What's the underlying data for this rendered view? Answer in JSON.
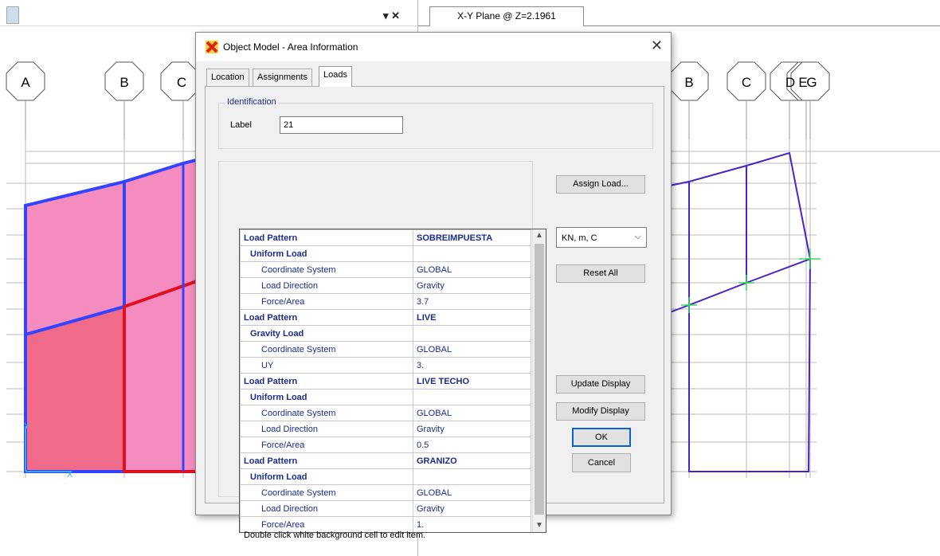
{
  "left_view": {
    "pane_controls": "▾ ✕",
    "grid_labels": [
      "A",
      "B",
      "C"
    ]
  },
  "right_view": {
    "tab_label": "X-Y Plane @ Z=2.1961",
    "grid_labels": [
      "B",
      "C",
      "D",
      "E",
      "G"
    ]
  },
  "dialog": {
    "title": "Object Model - Area Information",
    "close_glyph": "✕",
    "tabs": [
      "Location",
      "Assignments",
      "Loads"
    ],
    "identification": {
      "legend": "Identification",
      "label_caption": "Label",
      "label_value": "21"
    },
    "grid_rows": [
      {
        "kind": "pattern",
        "name": "Load Pattern",
        "value": "SOBREIMPUESTA"
      },
      {
        "kind": "sub",
        "name": "Uniform Load",
        "value": ""
      },
      {
        "kind": "prop",
        "name": "Coordinate System",
        "value": "GLOBAL"
      },
      {
        "kind": "prop",
        "name": "Load Direction",
        "value": "Gravity"
      },
      {
        "kind": "prop",
        "name": "Force/Area",
        "value": "3.7"
      },
      {
        "kind": "pattern",
        "name": "Load Pattern",
        "value": "LIVE"
      },
      {
        "kind": "sub",
        "name": "Gravity Load",
        "value": ""
      },
      {
        "kind": "prop",
        "name": "Coordinate System",
        "value": "GLOBAL"
      },
      {
        "kind": "prop",
        "name": "UY",
        "value": "3."
      },
      {
        "kind": "pattern",
        "name": "Load Pattern",
        "value": "LIVE TECHO"
      },
      {
        "kind": "sub",
        "name": "Uniform Load",
        "value": ""
      },
      {
        "kind": "prop",
        "name": "Coordinate System",
        "value": "GLOBAL"
      },
      {
        "kind": "prop",
        "name": "Load Direction",
        "value": "Gravity"
      },
      {
        "kind": "prop",
        "name": "Force/Area",
        "value": "0.5"
      },
      {
        "kind": "pattern",
        "name": "Load Pattern",
        "value": "GRANIZO"
      },
      {
        "kind": "sub",
        "name": "Uniform Load",
        "value": ""
      },
      {
        "kind": "prop",
        "name": "Coordinate System",
        "value": "GLOBAL"
      },
      {
        "kind": "prop",
        "name": "Load Direction",
        "value": "Gravity"
      },
      {
        "kind": "prop",
        "name": "Force/Area",
        "value": "1."
      }
    ],
    "hint": "Double click white background cell to edit item.",
    "buttons": {
      "assign_load": "Assign Load...",
      "units": "KN, m, C",
      "reset_all": "Reset All",
      "update_display": "Update Display",
      "modify_display": "Modify Display",
      "ok": "OK",
      "cancel": "Cancel"
    }
  },
  "colors": {
    "pattern_text": "#1b2c8f",
    "left_fill_pink": "#f48cc0",
    "left_fill_red": "#f06a8a",
    "frame_blue": "#3344ff",
    "selected_red": "#e01020",
    "right_frame": "#4a22cc",
    "axis_green": "#33dd55"
  }
}
